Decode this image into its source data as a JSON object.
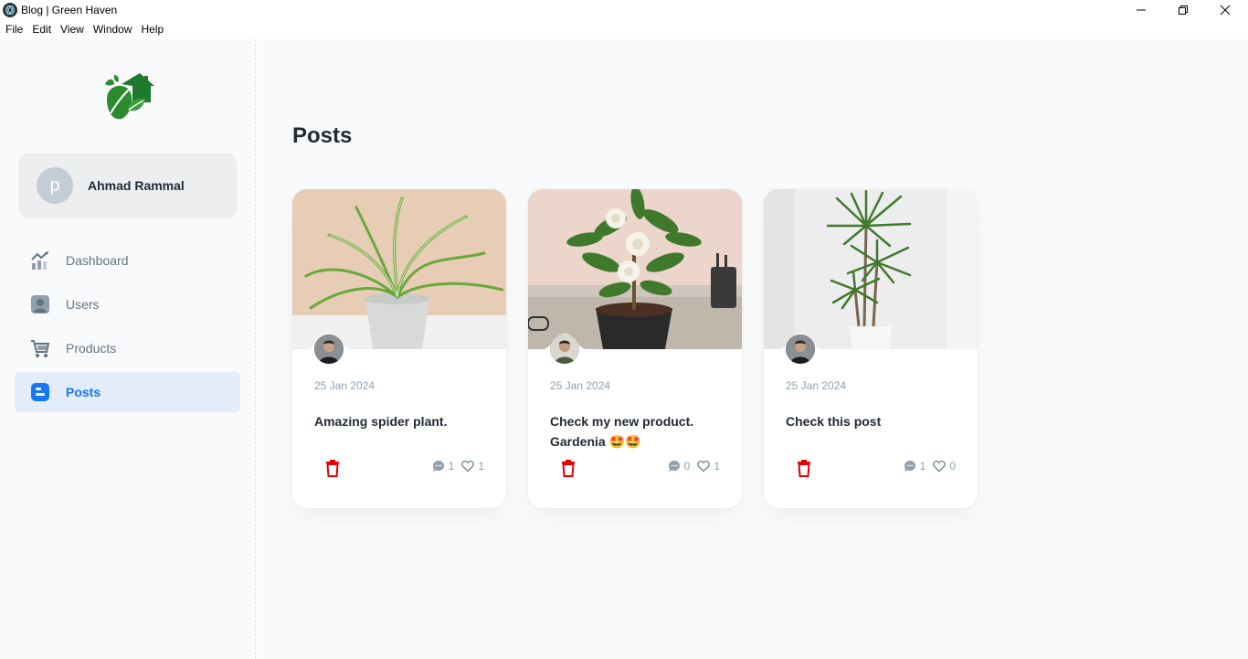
{
  "window": {
    "title": "Blog | Green Haven",
    "menu": [
      "File",
      "Edit",
      "View",
      "Window",
      "Help"
    ]
  },
  "sidebar": {
    "account": {
      "initial": "p",
      "name": "Ahmad Rammal"
    },
    "items": [
      {
        "label": "Dashboard",
        "icon": "chart-icon",
        "active": false
      },
      {
        "label": "Users",
        "icon": "user-icon",
        "active": false
      },
      {
        "label": "Products",
        "icon": "cart-icon",
        "active": false
      },
      {
        "label": "Posts",
        "icon": "blog-icon",
        "active": true
      }
    ]
  },
  "main": {
    "title": "Posts",
    "posts": [
      {
        "date": "25 Jan 2024",
        "text": "Amazing spider plant.",
        "comments": "1",
        "likes": "1"
      },
      {
        "date": "25 Jan 2024",
        "text": "Check my new product. Gardenia 🤩🤩",
        "comments": "0",
        "likes": "1"
      },
      {
        "date": "25 Jan 2024",
        "text": "Check this post",
        "comments": "1",
        "likes": "0"
      }
    ]
  },
  "colors": {
    "accent": "#1877f2",
    "danger": "#e00000",
    "brand_green": "#1e7a2c"
  }
}
